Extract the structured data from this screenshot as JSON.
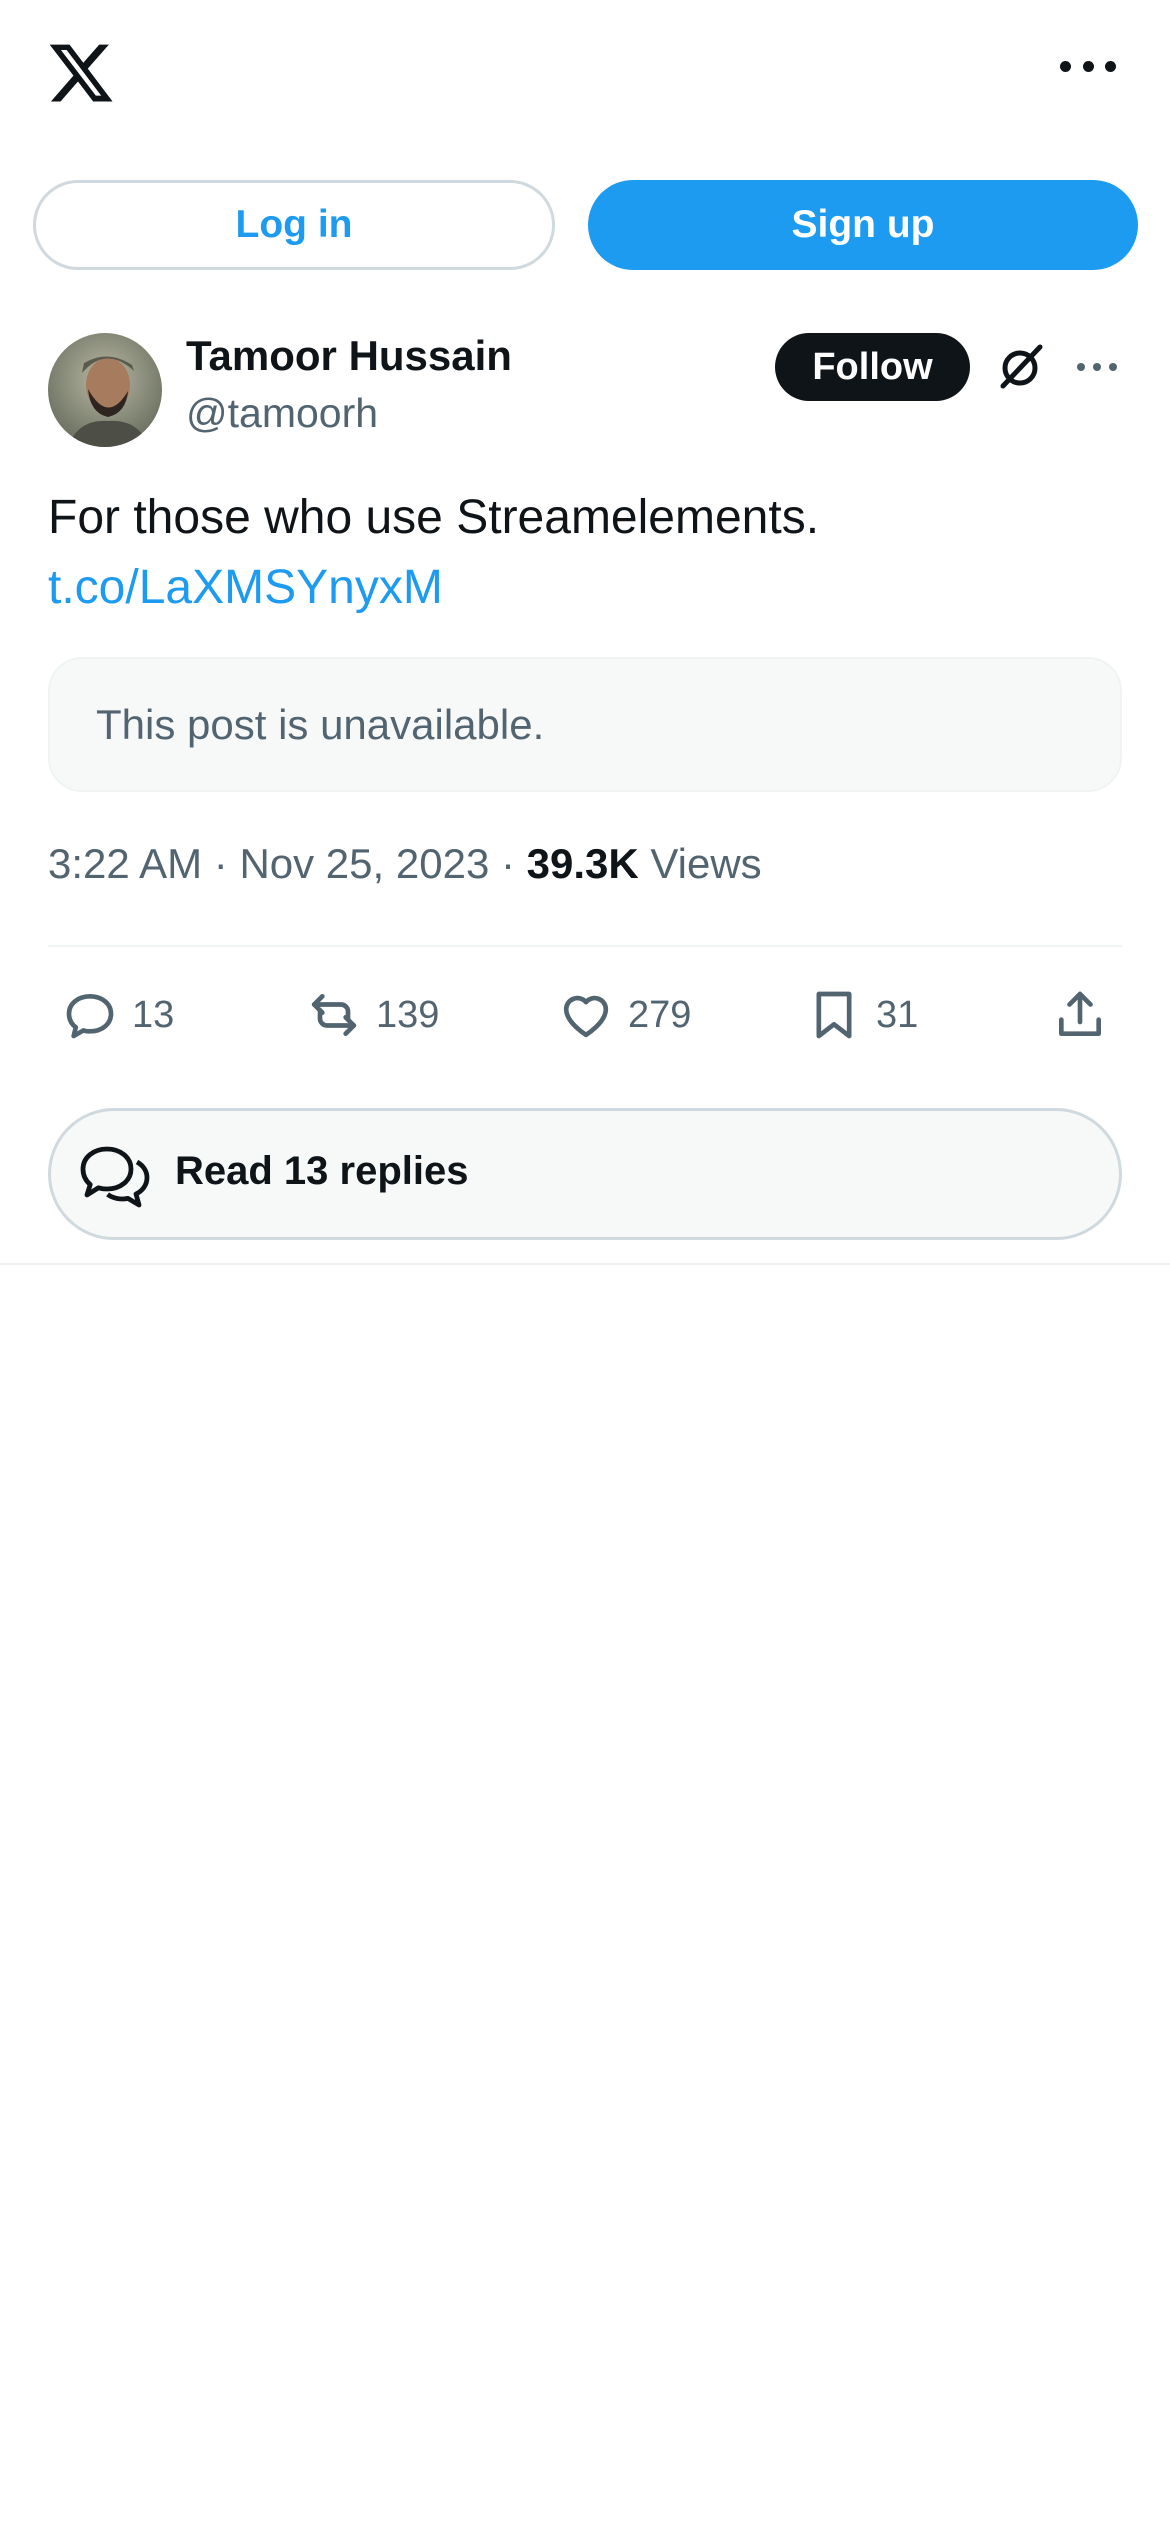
{
  "header": {
    "logo_icon": "x-logo-icon",
    "more_icon": "more-horizontal-icon"
  },
  "auth": {
    "login_label": "Log in",
    "signup_label": "Sign up"
  },
  "post": {
    "author": {
      "name": "Tamoor Hussain",
      "handle": "@tamoorh",
      "avatar_icon": "avatar-photo"
    },
    "follow_label": "Follow",
    "grok_icon": "grok-icon",
    "more_icon": "more-horizontal-icon",
    "text": "For those who use Streamelements.",
    "link": "t.co/LaXMSYnyxM",
    "quoted_unavailable": "This post is unavailable.",
    "meta": {
      "time": "3:22 AM",
      "separator": "·",
      "date": "Nov 25, 2023",
      "views_count": "39.3K",
      "views_label": "Views"
    },
    "actions": {
      "replies": "13",
      "reposts": "139",
      "likes": "279",
      "bookmarks": "31"
    },
    "read_replies_label": "Read 13 replies"
  },
  "colors": {
    "accent": "#1d9bf0",
    "text_primary": "#0f1419",
    "text_secondary": "#536471",
    "border": "#cfd9de"
  }
}
